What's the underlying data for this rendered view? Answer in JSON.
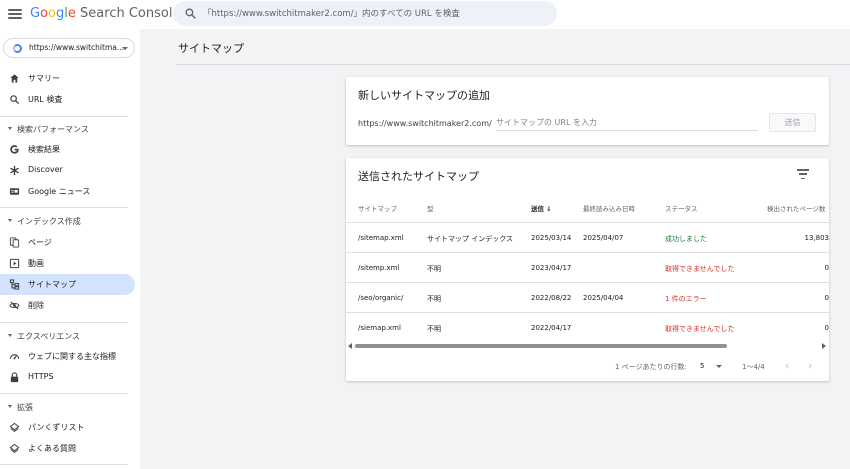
{
  "app": {
    "logo_google": [
      "G",
      "o",
      "o",
      "g",
      "l",
      "e"
    ],
    "logo_product": "Search Console"
  },
  "search": {
    "placeholder": "「https://www.switchitmaker2.com/」内のすべての URL を検査"
  },
  "property": {
    "label": "https://www.switchitma..."
  },
  "sidebar": {
    "items": [
      {
        "label": "サマリー",
        "icon": "home-icon"
      },
      {
        "label": "URL 検査",
        "icon": "search-icon"
      },
      {
        "section": "検索パフォーマンス"
      },
      {
        "label": "検索結果",
        "icon": "google-g-icon"
      },
      {
        "label": "Discover",
        "icon": "asterisk-icon"
      },
      {
        "label": "Google ニュース",
        "icon": "news-icon"
      },
      {
        "section": "インデックス作成"
      },
      {
        "label": "ページ",
        "icon": "pages-icon"
      },
      {
        "label": "動画",
        "icon": "video-icon"
      },
      {
        "label": "サイトマップ",
        "icon": "sitemap-icon",
        "active": true
      },
      {
        "label": "削除",
        "icon": "visibility-off-icon"
      },
      {
        "section": "エクスペリエンス"
      },
      {
        "label": "ウェブに関する主な指標",
        "icon": "speedometer-icon"
      },
      {
        "label": "HTTPS",
        "icon": "lock-icon"
      },
      {
        "section": "拡張"
      },
      {
        "label": "パンくずリスト",
        "icon": "layers-icon"
      },
      {
        "label": "よくある質問",
        "icon": "layers-icon"
      }
    ]
  },
  "main": {
    "page_title": "サイトマップ",
    "add_card": {
      "title": "新しいサイトマップの追加",
      "url_prefix": "https://www.switchitmaker2.com/",
      "input_placeholder": "サイトマップの URL を入力",
      "submit_label": "送信"
    },
    "submitted_card": {
      "title": "送信されたサイトマップ",
      "columns": [
        "サイトマップ",
        "型",
        "送信",
        "最終読み込み日時",
        "ステータス",
        "検出されたページ数"
      ],
      "sort_arrow": "↓",
      "rows": [
        {
          "sitemap": "/sitemap.xml",
          "type": "サイトマップ インデックス",
          "submitted": "2025/03/14",
          "last_read": "2025/04/07",
          "status": "成功しました",
          "status_kind": "ok",
          "pages": "13,803"
        },
        {
          "sitemap": "/sitemp.xml",
          "type": "不明",
          "submitted": "2023/04/17",
          "last_read": "",
          "status": "取得できませんでした",
          "status_kind": "err",
          "pages": "0"
        },
        {
          "sitemap": "/seo/organic/",
          "type": "不明",
          "submitted": "2022/08/22",
          "last_read": "2025/04/04",
          "status": "1 件のエラー",
          "status_kind": "err",
          "pages": "0"
        },
        {
          "sitemap": "/siemap.xml",
          "type": "不明",
          "submitted": "2022/04/17",
          "last_read": "",
          "status": "取得できませんでした",
          "status_kind": "err",
          "pages": "0"
        }
      ],
      "pagination": {
        "rows_per_page_label": "1 ページあたりの行数:",
        "rows_per_page_value": "5",
        "range": "1〜4/4",
        "prev": "‹",
        "next": "›"
      }
    }
  },
  "colors": {
    "accent": "#1a73e8",
    "active_nav_bg": "#d3e3fd",
    "success": "#188038",
    "error": "#d93025"
  }
}
